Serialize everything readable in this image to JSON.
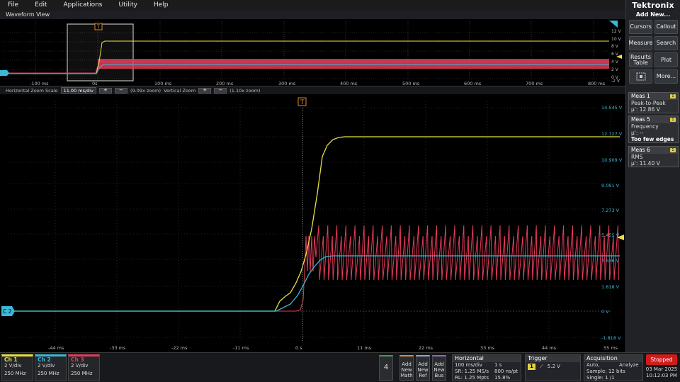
{
  "menu": [
    "File",
    "Edit",
    "Applications",
    "Utility",
    "Help"
  ],
  "brand": "Tektronix",
  "right_panel": {
    "add_new": "Add New...",
    "buttons": [
      "Cursors",
      "Callout",
      "Measure",
      "Search",
      "Results Table",
      "Plot",
      "",
      "More..."
    ]
  },
  "measurements": [
    {
      "name": "Meas 1",
      "line1": "Peak-to-Peak",
      "line2": "μ': 12.86 V",
      "line3": ""
    },
    {
      "name": "Meas 5",
      "line1": "Frequency",
      "line2": "μ': --",
      "line3": "Too few edges"
    },
    {
      "name": "Meas 6",
      "line1": "RMS",
      "line2": "μ': 11.40 V",
      "line3": ""
    }
  ],
  "overview": {
    "title": "Waveform View",
    "x_ticks": [
      "-100 ms",
      "0s",
      "100 ms",
      "200 ms",
      "300 ms",
      "400 ms",
      "500 ms",
      "600 ms",
      "700 ms",
      "800 ms"
    ],
    "y_ticks": [
      "12 V",
      "10 V",
      "8 V",
      "6 V",
      "4 V",
      "2 V",
      "0 V",
      "-2 V"
    ]
  },
  "zoombar": {
    "label": "Horizontal Zoom Scale",
    "value": "11.00 ms/div",
    "plus": "+",
    "minus": "−",
    "zoom_x": "(9.09x zoom)",
    "vertical_label": "Vertical Zoom",
    "zoom_y": "(1.10x zoom)"
  },
  "main": {
    "trigger_label": "T",
    "channel_marker": "C 2",
    "x_ticks": [
      "-44 ms",
      "-33 ms",
      "-22 ms",
      "-11 ms",
      "0 s",
      "11 ms",
      "22 ms",
      "33 ms",
      "44 ms",
      "55 ms"
    ],
    "y_ticks": [
      "14.545 V",
      "12.727 V",
      "10.909 V",
      "9.091 V",
      "7.273 V",
      "5.455 V",
      "3.636 V",
      "1.818 V",
      "0 V",
      "-1.818 V"
    ]
  },
  "channels": [
    {
      "name": "Ch 1",
      "scale": "2 V/div",
      "bw": "250 MHz",
      "color": "#e8e040"
    },
    {
      "name": "Ch 2",
      "scale": "2 V/div",
      "bw": "250 MHz",
      "color": "#3ab8d8"
    },
    {
      "name": "Ch 3",
      "scale": "2 V/div",
      "bw": "250 MHz",
      "color": "#e33c5a"
    }
  ],
  "bottom": {
    "num_button": "4",
    "add_math": "Add New Math",
    "add_ref": "Add New Ref",
    "add_bus": "Add New Bus",
    "horizontal": {
      "title": "Horizontal",
      "scale": "100 ms/div",
      "record": "1 s",
      "sr": "SR: 1.25 MS/s",
      "pt": "800 ns/pt",
      "rl": "RL: 1.25 Mpts",
      "pos": "15.8%"
    },
    "trigger": {
      "title": "Trigger",
      "ch": "1",
      "level": "5.2 V"
    },
    "acquisition": {
      "title": "Acquisition",
      "mode": "Auto,",
      "analyze": "Analyze",
      "sample": "Sample: 12 bits",
      "single": "Single: 1 /1"
    },
    "status": "Stopped",
    "date": "03 Mar 2025",
    "time": "10:12:03 PM"
  },
  "colors": {
    "ch1": "#e8e040",
    "ch2": "#3ab8d8",
    "ch3": "#e33c5a",
    "trigger": "#e08a2c"
  }
}
